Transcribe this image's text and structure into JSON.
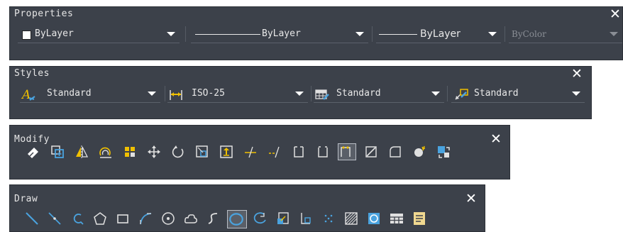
{
  "properties": {
    "title": "Properties",
    "close": "✕",
    "color": "ByLayer",
    "linetype": "ByLayer",
    "lineweight": "ByLayer",
    "plotstyle": "ByColor"
  },
  "styles": {
    "title": "Styles",
    "close": "✕",
    "text_style": "Standard",
    "dim_style": "ISO-25",
    "table_style": "Standard",
    "mleader_style": "Standard"
  },
  "modify": {
    "title": "Modify",
    "close": "✕",
    "tools": [
      "erase-icon",
      "copy-icon",
      "mirror-icon",
      "offset-icon",
      "array-icon",
      "move-icon",
      "rotate-icon",
      "scale-icon",
      "stretch-icon",
      "trim-icon",
      "extend-icon",
      "break-at-point-icon",
      "break-icon",
      "join-icon",
      "chamfer-icon",
      "fillet-icon",
      "blend-curves-icon",
      "explode-icon"
    ]
  },
  "draw": {
    "title": "Draw",
    "close": "✕",
    "tools": [
      "line-icon",
      "construction-line-icon",
      "polyline-icon",
      "polygon-icon",
      "rectangle-icon",
      "arc-icon",
      "circle-icon",
      "revision-cloud-icon",
      "spline-icon",
      "ellipse-icon",
      "ellipse-arc-icon",
      "insert-block-icon",
      "make-block-icon",
      "point-icon",
      "hatch-icon",
      "region-icon",
      "table-icon",
      "multiline-text-icon"
    ]
  },
  "colors": {
    "panel_bg": "#3c414a",
    "text": "#e8e8e8",
    "accent_yellow": "#f0c000",
    "accent_blue": "#4aa3df"
  }
}
